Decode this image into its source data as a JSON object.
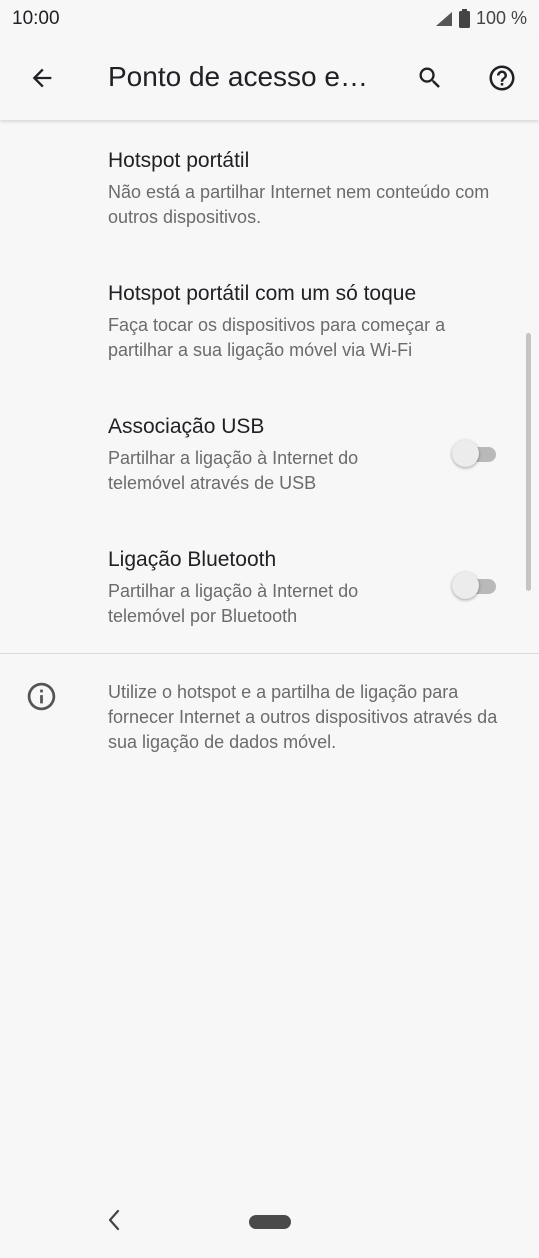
{
  "status_bar": {
    "time": "10:00",
    "battery_text": "100 %",
    "icons": [
      "signal-icon",
      "battery-icon"
    ]
  },
  "app_bar": {
    "title": "Ponto de acesso e…",
    "icons": [
      "back-arrow-icon",
      "search-icon",
      "help-icon"
    ]
  },
  "settings": {
    "items": [
      {
        "title": "Hotspot portátil",
        "summary": "Não está a partilhar Internet nem conteúdo com outros dispositivos."
      },
      {
        "title": "Hotspot portátil com um só toque",
        "summary": "Faça tocar os dispositivos para começar a partilhar a sua ligação móvel via Wi-Fi"
      },
      {
        "title": "Associação USB",
        "summary": "Partilhar a ligação à Internet do telemóvel através de USB",
        "toggle_on": false
      },
      {
        "title": "Ligação Bluetooth",
        "summary": "Partilhar a ligação à Internet do telemóvel por Bluetooth",
        "toggle_on": false
      }
    ]
  },
  "footer": {
    "icon": "info-icon",
    "text": "Utilize o hotspot e a partilha de ligação para fornecer Internet a outros dispositivos através da sua ligação de dados móvel."
  },
  "nav_bar": {
    "icons": [
      "nav-back-icon",
      "home-pill-icon"
    ]
  }
}
